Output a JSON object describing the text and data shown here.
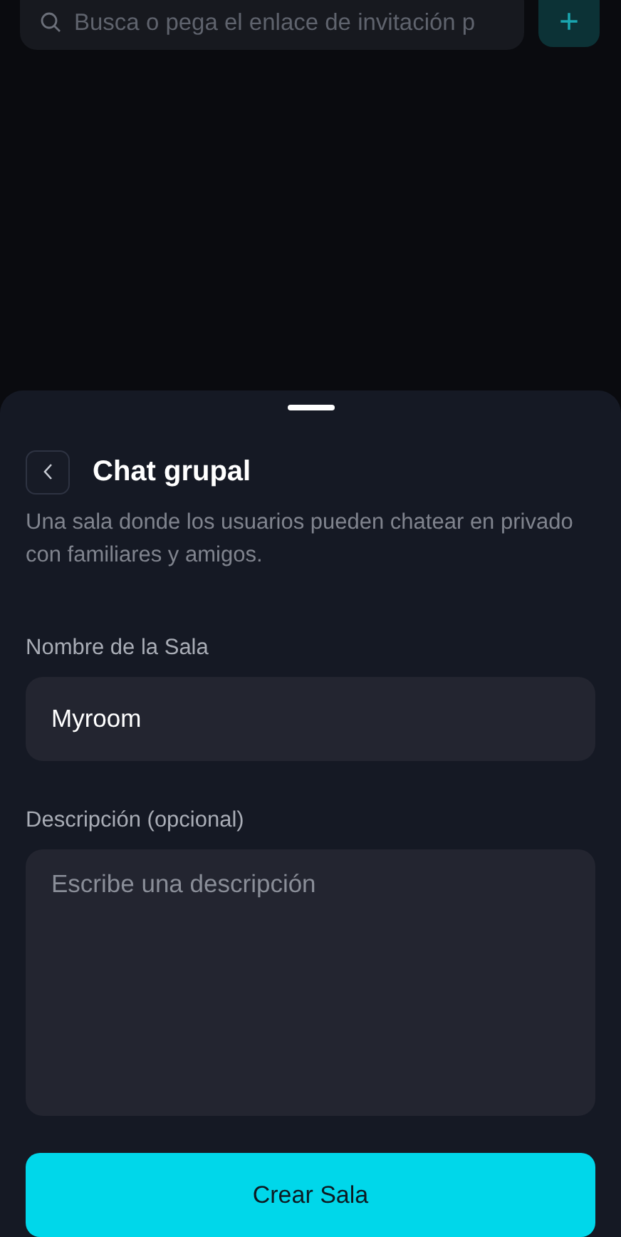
{
  "search": {
    "placeholder": "Busca o pega el enlace de invitación p"
  },
  "add_button": {
    "label": "+"
  },
  "sheet": {
    "title": "Chat grupal",
    "description": "Una sala donde los usuarios pueden chatear en privado con familiares y amigos.",
    "fields": [
      {
        "kind": "input",
        "label": "Nombre de la Sala",
        "value": "Myroom"
      },
      {
        "kind": "textarea",
        "label": "Descripción (opcional)",
        "placeholder": "Escribe una descripción"
      }
    ],
    "submit": {
      "label": "Crear Sala"
    }
  }
}
